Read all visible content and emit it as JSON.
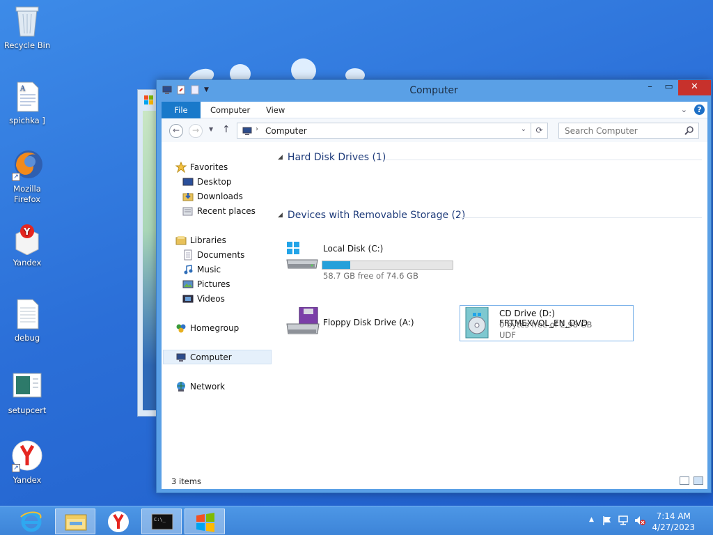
{
  "desktop": {
    "icons": [
      {
        "label": "Recycle Bin",
        "icon": "recycle-bin-icon"
      },
      {
        "label": "spichka ]",
        "icon": "document-icon"
      },
      {
        "label": "Mozilla Firefox",
        "icon": "firefox-icon"
      },
      {
        "label": "Yandex",
        "icon": "yandex-box-icon"
      },
      {
        "label": "debug",
        "icon": "text-file-icon"
      },
      {
        "label": "setupcert",
        "icon": "image-file-icon"
      },
      {
        "label": "Yandex",
        "icon": "yandex-browser-icon"
      }
    ]
  },
  "window": {
    "title": "Computer",
    "ribbon": {
      "tabs": [
        "File",
        "Computer",
        "View"
      ],
      "help": "?"
    },
    "address": {
      "location": "Computer",
      "search_placeholder": "Search Computer"
    },
    "nav": {
      "favorites": "Favorites",
      "desktop": "Desktop",
      "downloads": "Downloads",
      "recent": "Recent places",
      "libraries": "Libraries",
      "documents": "Documents",
      "music": "Music",
      "pictures": "Pictures",
      "videos": "Videos",
      "homegroup": "Homegroup",
      "computer": "Computer",
      "network": "Network"
    },
    "groups": {
      "hdd": {
        "header": "Hard Disk Drives (1)",
        "drive": {
          "name": "Local Disk (C:)",
          "free": "58.7 GB free of 74.6 GB",
          "used_fraction": 0.213
        }
      },
      "removable": {
        "header": "Devices with Removable Storage (2)",
        "floppy": {
          "name": "Floppy Disk Drive (A:)"
        },
        "cd": {
          "name": "CD Drive (D:) FRTMEXVOL_EN_DVD",
          "free": "0 bytes free of 2.98 GB",
          "fs": "UDF"
        }
      }
    },
    "status": {
      "items": "3 items"
    }
  },
  "taskbar": {
    "time": "7:14 AM",
    "date": "4/27/2023",
    "apps": [
      "internet-explorer-icon",
      "file-explorer-icon",
      "yandex-icon",
      "cmd-icon",
      "windows-icon"
    ]
  },
  "colors": {
    "accent": "#1979ca",
    "window_frame": "#5aa0e6",
    "close": "#c7312c",
    "bar_fill": "#26a0da"
  }
}
